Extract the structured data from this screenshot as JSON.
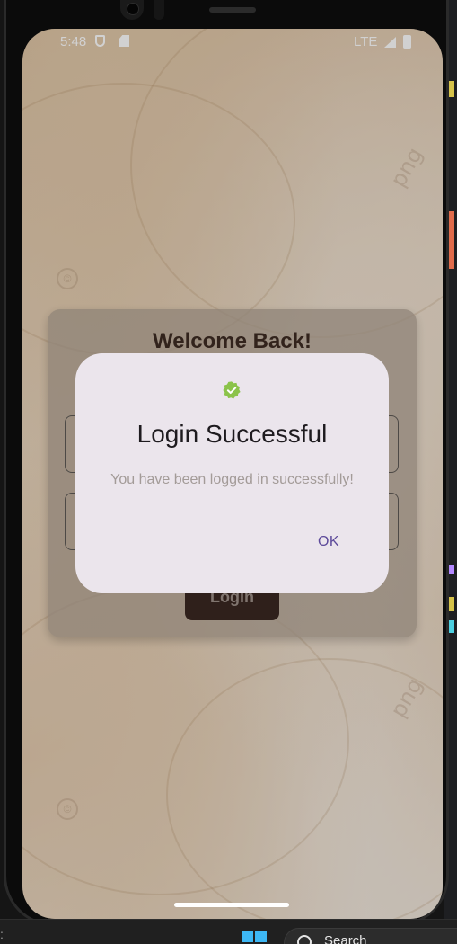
{
  "status_bar": {
    "time": "5:48",
    "network": "LTE",
    "icons": [
      "shield-icon",
      "sim-card-icon",
      "signal-icon",
      "battery-icon"
    ]
  },
  "login_card": {
    "title": "Welcome Back!",
    "button_label": "Login"
  },
  "dialog": {
    "icon": "verified-check-icon",
    "icon_color": "#8bc34a",
    "title": "Login Successful",
    "message": "You have been logged in successfully!",
    "ok_label": "OK"
  },
  "taskbar": {
    "search_label": "Search"
  },
  "colors": {
    "dialog_bg": "#ebe5ec",
    "accent": "#5d4a9a",
    "button_bg": "#3a2822"
  }
}
